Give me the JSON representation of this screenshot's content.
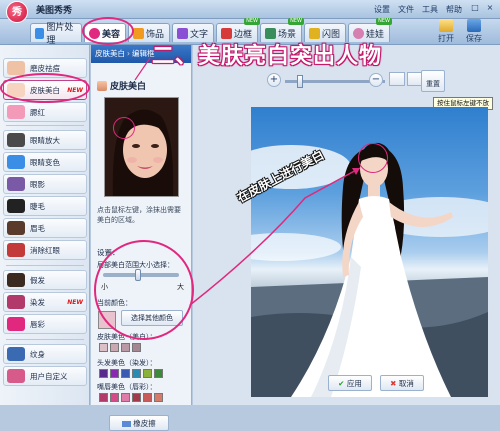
{
  "app": {
    "title": "美图秀秀",
    "logo_text": "秀"
  },
  "top_menu": [
    "设置",
    "文件",
    "工具",
    "帮助"
  ],
  "window_controls": [
    "-",
    "□",
    "×"
  ],
  "tabs": [
    {
      "label": "图片处理",
      "icon": "image-icon",
      "color": "#3a8ee6"
    },
    {
      "label": "美容",
      "icon": "face-icon",
      "color": "#e0287e",
      "active": true
    },
    {
      "label": "饰品",
      "icon": "accessory-icon",
      "color": "#f09a1f"
    },
    {
      "label": "文字",
      "icon": "text-icon",
      "color": "#8b4fd6"
    },
    {
      "label": "边框",
      "icon": "frame-icon",
      "color": "#d63a3a",
      "badge": "NEW"
    },
    {
      "label": "场景",
      "icon": "scene-icon",
      "color": "#3a8e5c",
      "badge": "NEW"
    },
    {
      "label": "闪图",
      "icon": "flash-icon",
      "color": "#e0b21f"
    },
    {
      "label": "娃娃",
      "icon": "doll-icon",
      "color": "#d67fb1",
      "badge": "NEW"
    }
  ],
  "toolbar": {
    "open_label": "打开",
    "save_label": "保存"
  },
  "sidebar": {
    "items": [
      {
        "label": "磨皮祛痘",
        "icon": "skin-smooth-icon",
        "color": "#f0c2a5"
      },
      {
        "label": "皮肤美白",
        "icon": "skin-whiten-icon",
        "color": "#f6d4c0",
        "new": "NEW",
        "selected": true
      },
      {
        "label": "腮红",
        "icon": "blush-icon",
        "color": "#f29ab8"
      },
      {
        "label": "眼睛放大",
        "icon": "eye-enlarge-icon",
        "color": "#4a4a4a"
      },
      {
        "label": "眼睛变色",
        "icon": "eye-color-icon",
        "color": "#3a8ee6"
      },
      {
        "label": "眼影",
        "icon": "eyeshadow-icon",
        "color": "#7a5aa6"
      },
      {
        "label": "睫毛",
        "icon": "eyelash-icon",
        "color": "#222222"
      },
      {
        "label": "眉毛",
        "icon": "eyebrow-icon",
        "color": "#5a3a2a"
      },
      {
        "label": "消除红眼",
        "icon": "red-eye-icon",
        "color": "#c23a3a"
      },
      {
        "label": "假发",
        "icon": "wig-icon",
        "color": "#3a2a1f"
      },
      {
        "label": "染发",
        "icon": "hair-dye-icon",
        "color": "#b23a6a",
        "new": "NEW"
      },
      {
        "label": "唇彩",
        "icon": "lipstick-icon",
        "color": "#e0287e"
      },
      {
        "label": "纹身",
        "icon": "tattoo-icon",
        "color": "#3a6ab2"
      },
      {
        "label": "用户自定义",
        "icon": "custom-icon",
        "color": "#d65a8a"
      }
    ]
  },
  "subpanel": {
    "breadcrumb": [
      "皮肤美白",
      "编辑框"
    ],
    "title": "皮肤美白",
    "help_text": "点击鼠标左键，涂抹出需要美白的区域。",
    "settings_label": "设置：",
    "brush_size_label": "局部美白范围大小选择：",
    "brush_size_value": 0.42,
    "size_min": "小",
    "size_max": "大",
    "current_color_label": "当前颜色：",
    "choose_color_label": "选择其他颜色",
    "current_color": "#e8c3cd",
    "skin_label": "皮肤美色（美白）：",
    "skin_colors": [
      "#dcc0c8",
      "#c9a8b2",
      "#b899a4",
      "#a58693"
    ],
    "hair_label": "头发美色（染发）：",
    "hair_colors": [
      "#5a2a8a",
      "#8a2ab2",
      "#3a5ab2",
      "#2a8ab2",
      "#8ab23a",
      "#3a8a3a",
      "#c23a8a",
      "#d67a2a",
      "#a2283a",
      "#6a3a2a",
      "#8a5a3a",
      "#3a3a3a"
    ],
    "lip_label": "嘴唇美色（唇彩）：",
    "lip_colors": [
      "#b23a6a",
      "#d64a8a",
      "#e07aa8",
      "#a23a4a",
      "#c85a5a",
      "#d67a6a",
      "#b28aa6",
      "#8a5a7a",
      "#6a3a4a",
      "#a26a7a",
      "#c29aa8",
      "#8a3a3a"
    ],
    "eraser_label": "橡皮擦"
  },
  "canvas": {
    "zoom_value": 0.12,
    "reset_label": "重置",
    "tooltip": "按住鼠标左键不放",
    "apply_label": "应用",
    "cancel_label": "取消"
  },
  "annotations": {
    "step_heading": "二、美肤亮白突出人物",
    "callout": "在皮肤上进行美白",
    "accent_color": "#e0287e"
  }
}
